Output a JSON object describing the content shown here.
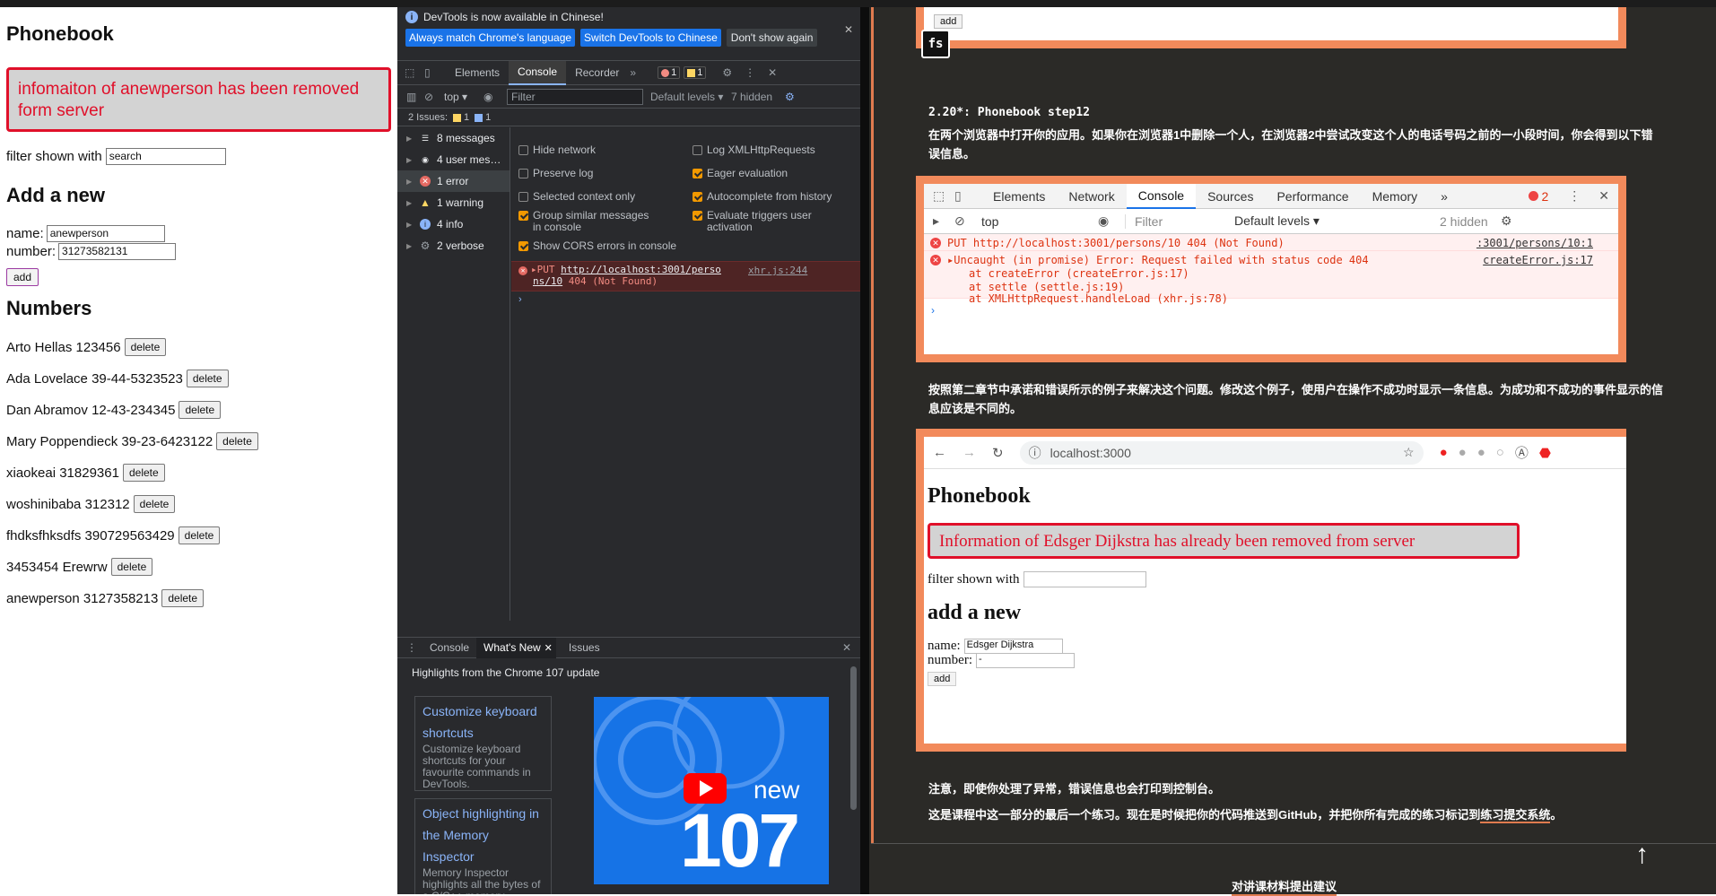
{
  "app": {
    "title": "Phonebook",
    "notification": "infomaiton of anewperson has been removed form server",
    "filter_label": "filter shown with",
    "filter_value": "search",
    "add_title": "Add a new",
    "name_label": "name:",
    "name_value": "anewperson",
    "number_label": "number:",
    "number_value": "31273582131",
    "add_button": "add",
    "numbers_title": "Numbers",
    "delete_label": "delete",
    "persons": [
      {
        "name": "Arto Hellas",
        "number": "123456"
      },
      {
        "name": "Ada Lovelace",
        "number": "39-44-5323523"
      },
      {
        "name": "Dan Abramov",
        "number": "12-43-234345"
      },
      {
        "name": "Mary Poppendieck",
        "number": "39-23-6423122"
      },
      {
        "name": "xiaokeai",
        "number": "31829361"
      },
      {
        "name": "woshinibaba",
        "number": "312312"
      },
      {
        "name": "fhdksfhksdfs",
        "number": "390729563429"
      },
      {
        "name": "3453454",
        "number": "Erewrw"
      },
      {
        "name": "anewperson",
        "number": "3127358213"
      }
    ]
  },
  "devtools": {
    "info_banner": "DevTools is now available in Chinese!",
    "btn_match": "Always match Chrome's language",
    "btn_switch": "Switch DevTools to Chinese",
    "btn_dont": "Don't show again",
    "tabs": [
      "Elements",
      "Console",
      "Recorder"
    ],
    "more": "»",
    "err_count": "1",
    "warn_count": "1",
    "context": "top ▾",
    "filter_placeholder": "Filter",
    "levels": "Default levels ▾",
    "hidden": "7 hidden",
    "issues_label": "2 Issues:",
    "issues_warn": "1",
    "issues_info": "1",
    "sidebar": [
      {
        "label": "8 messages",
        "icon": "list-icon"
      },
      {
        "label": "4 user mes…",
        "icon": "user-icon"
      },
      {
        "label": "1 error",
        "icon": "error-icon"
      },
      {
        "label": "1 warning",
        "icon": "warning-icon"
      },
      {
        "label": "4 info",
        "icon": "info-icon"
      },
      {
        "label": "2 verbose",
        "icon": "gear-icon"
      }
    ],
    "settings": {
      "hide_network": "Hide network",
      "preserve_log": "Preserve log",
      "selected_context": "Selected context only",
      "group_similar": "Group similar messages in console",
      "show_cors": "Show CORS errors in console",
      "log_xhr": "Log XMLHttpRequests",
      "eager_eval": "Eager evaluation",
      "autocomplete": "Autocomplete from history",
      "evaluate_triggers": "Evaluate triggers user activation"
    },
    "error_line": {
      "method": "▸PUT",
      "url1": "http://localhost:3001/perso",
      "url2": "ns/10",
      "status": "404 (Not Found)",
      "source": "xhr.js:244"
    },
    "prompt": "›",
    "drawer_tabs": [
      "Console",
      "What's New",
      "Issues"
    ],
    "highlights": "Highlights from the Chrome 107 update",
    "cards": [
      {
        "title": "Customize keyboard shortcuts",
        "desc": "Customize keyboard shortcuts for your favourite commands in DevTools."
      },
      {
        "title": "Object highlighting in the Memory Inspector",
        "desc": "Memory Inspector highlights all the bytes of a C/C++ memory"
      }
    ],
    "promo_new": "new",
    "promo_version": "107"
  },
  "docs": {
    "top_add": "add",
    "fs_badge": "fs",
    "heading": "2.20*: Phonebook step12",
    "para1": "在两个浏览器中打开你的应用。如果你在浏览器1中删除一个人，在浏览器2中尝试改变这个人的电话号码之前的一小段时间，你会得到以下错误信息。",
    "console_shot": {
      "tabs": [
        "Elements",
        "Network",
        "Console",
        "Sources",
        "Performance",
        "Memory",
        "»"
      ],
      "err_count": "2",
      "context": "top",
      "filter": "Filter",
      "levels": "Default levels ▾",
      "hidden": "2 hidden",
      "line1": "PUT http://localhost:3001/persons/10 404 (Not Found)",
      "line1_src": ":3001/persons/10:1",
      "line2": "▸Uncaught (in promise) Error: Request failed with status code 404",
      "line2_src": "createError.js:17",
      "trace1": "at createError (createError.js:17)",
      "trace2": "at settle (settle.js:19)",
      "trace3": "at XMLHttpRequest.handleLoad (xhr.js:78)"
    },
    "para2": "按照第二章节中承诺和错误所示的例子来解决这个问题。修改这个例子，使用户在操作不成功时显示一条信息。为成功和不成功的事件显示的信息应该是不同的。",
    "browser_shot": {
      "url": "localhost:3000",
      "title": "Phonebook",
      "notification": "Information of Edsger Dijkstra has already been removed from server",
      "filter_label": "filter shown with",
      "add_title": "add a new",
      "name_label": "name:",
      "name_value": "Edsger Dijkstra",
      "number_label": "number:",
      "number_value": "-",
      "add_button": "add"
    },
    "para3": "注意，即使你处理了异常，错误信息也会打印到控制台。",
    "para4_prefix": "这是课程中这一部分的最后一个练习。现在是时候把你的代码推送到GitHub，并把你所有完成的练习标记到",
    "para4_link": "练习提交系统",
    "para4_suffix": "。",
    "up_arrow": "↑",
    "footer_link": "对讲课材料提出建议"
  }
}
